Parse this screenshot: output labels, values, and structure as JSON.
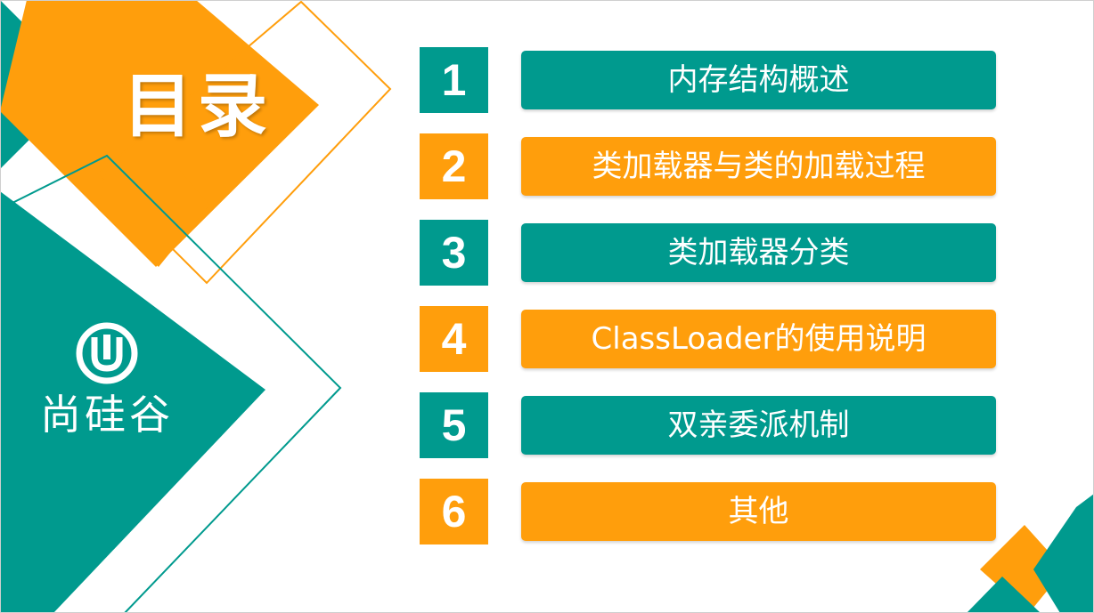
{
  "colors": {
    "teal": "#009A8E",
    "orange": "#FF9E0C",
    "background": "#ffffff"
  },
  "title": "目录",
  "logo": {
    "icon": "u-circle-logo-icon",
    "text": "尚硅谷"
  },
  "toc": [
    {
      "number": "1",
      "label": "内存结构概述",
      "color": "teal"
    },
    {
      "number": "2",
      "label": "类加载器与类的加载过程",
      "color": "orange"
    },
    {
      "number": "3",
      "label": "类加载器分类",
      "color": "teal"
    },
    {
      "number": "4",
      "label": "ClassLoader的使用说明",
      "color": "orange"
    },
    {
      "number": "5",
      "label": "双亲委派机制",
      "color": "teal"
    },
    {
      "number": "6",
      "label": "其他",
      "color": "orange"
    }
  ]
}
